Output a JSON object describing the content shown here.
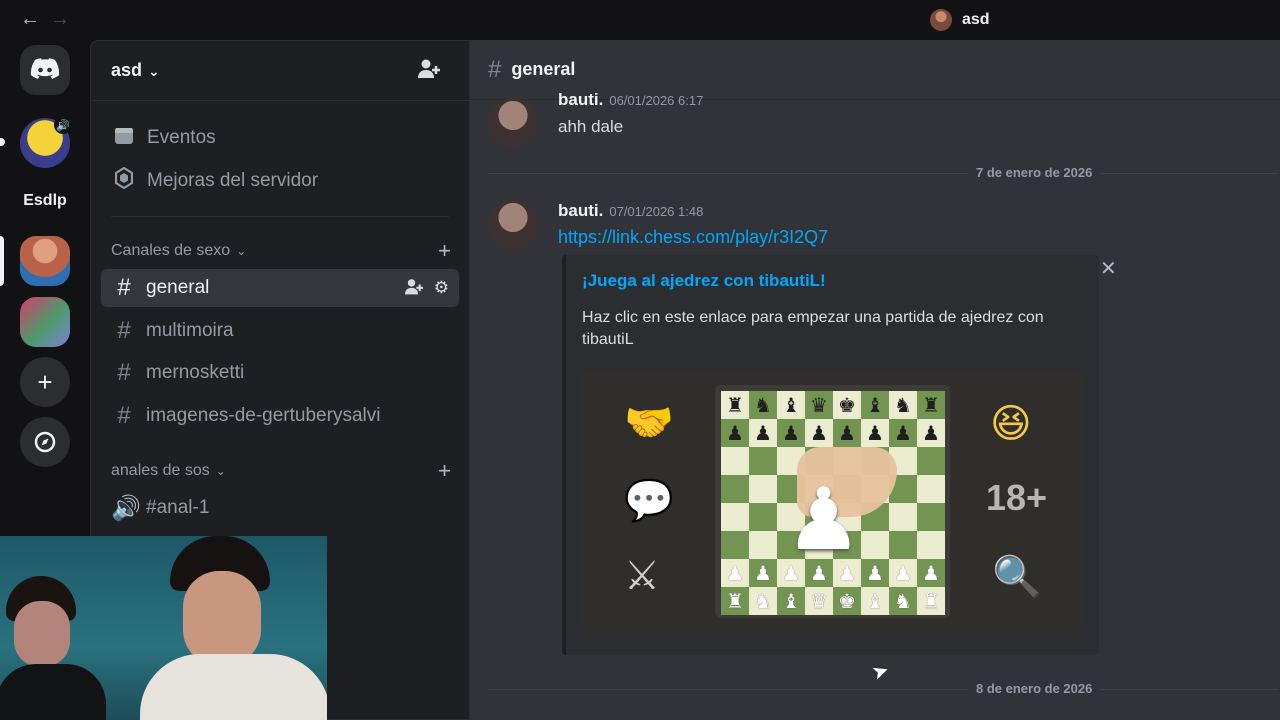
{
  "window": {
    "title": "asd",
    "back_icon": "←",
    "forward_icon": "→"
  },
  "rail": {
    "servers": [
      {
        "name": "discord-home",
        "icon": "discord-logo"
      },
      {
        "name": "minion-server"
      },
      {
        "name": "text-server",
        "label": "Esdlp"
      },
      {
        "name": "man-server"
      },
      {
        "name": "photo-server"
      }
    ],
    "add_label": "+",
    "explore_icon": "compass-icon"
  },
  "sidebar": {
    "server_name": "asd",
    "items": [
      {
        "label": "Eventos",
        "icon": "calendar-icon"
      },
      {
        "label": "Mejoras del servidor",
        "icon": "boost-icon"
      }
    ],
    "categories": [
      {
        "label": "Canales de sexo",
        "channels": [
          "general",
          "multimoira",
          "mernosketti",
          "imagenes-de-gertuberysalvi"
        ]
      },
      {
        "label": "anales de sos",
        "channels": [
          "#anal-1"
        ]
      }
    ]
  },
  "main": {
    "channel": "general",
    "messages": [
      {
        "author": "bauti.",
        "time": "06/01/2026 6:17",
        "text": "ahh dale"
      },
      {
        "author": "bauti.",
        "time": "07/01/2026 1:48",
        "link": "https://link.chess.com/play/r3I2Q7"
      }
    ],
    "date_separators": [
      "7 de enero de 2026",
      "8 de enero de 2026"
    ],
    "embed": {
      "title": "¡Juega al ajedrez con tibautiL!",
      "description": "Haz clic en este enlace para empezar una partida de ajedrez con tibautiL",
      "board_top": [
        "♜",
        "♞",
        "♝",
        "♛",
        "♚",
        "♝",
        "♞",
        "♜"
      ],
      "board_pawn": "♟",
      "board_bottom": [
        "♜",
        "♞",
        "♝",
        "♛",
        "♚",
        "♝",
        "♞",
        "♜"
      ]
    }
  },
  "colors": {
    "accent": "#5865f2",
    "link": "#00a8fc",
    "board_light": "#ebecd0",
    "board_dark": "#739552"
  }
}
